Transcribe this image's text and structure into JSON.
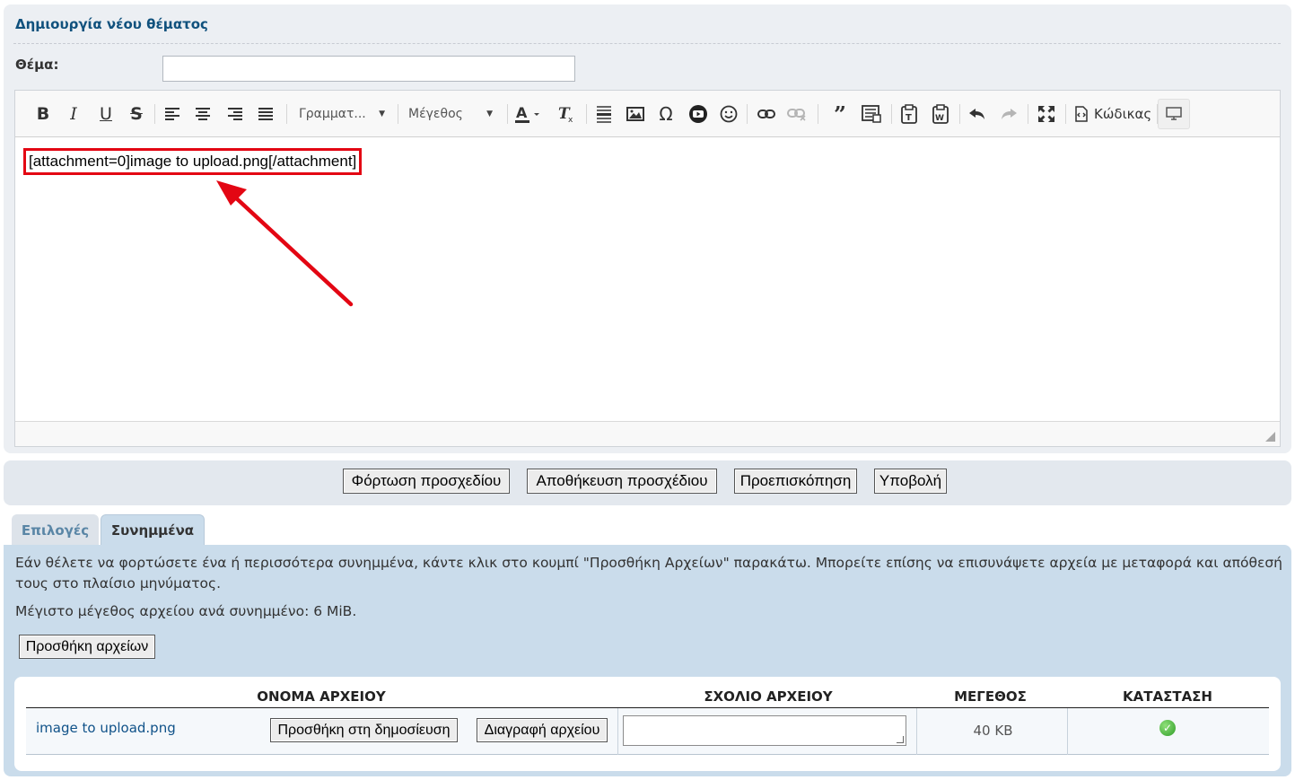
{
  "form": {
    "title": "Δημιουργία νέου θέματος",
    "subject_label": "Θέμα:",
    "subject_value": ""
  },
  "toolbar": {
    "font_combo": "Γραμματ...",
    "size_combo": "Μέγεθος",
    "source_label": "Κώδικας",
    "icons": [
      "bold-icon",
      "italic-icon",
      "underline-icon",
      "strike-icon",
      "align-left-icon",
      "align-center-icon",
      "align-right-icon",
      "justify-icon",
      "text-color-icon",
      "remove-format-icon",
      "horizontal-rule-icon",
      "image-icon",
      "special-char-icon",
      "youtube-icon",
      "smiley-icon",
      "link-icon",
      "unlink-icon",
      "blockquote-icon",
      "code-block-icon",
      "paste-text-icon",
      "paste-word-icon",
      "undo-icon",
      "redo-icon",
      "maximize-icon",
      "source-icon",
      "preview-icon"
    ]
  },
  "editor": {
    "content": "[attachment=0]image to upload.png[/attachment]",
    "highlight_color": "#e30613"
  },
  "actions": {
    "load_draft": "Φόρτωση προσχεδίου",
    "save_draft": "Αποθήκευση προσχέδιου",
    "preview": "Προεπισκόπηση",
    "submit": "Υποβολή"
  },
  "tabs": {
    "options": "Επιλογές",
    "attachments": "Συνημμένα"
  },
  "attachments": {
    "intro": "Εάν θέλετε να φορτώσετε ένα ή περισσότερα συνημμένα, κάντε κλικ στο κουμπί \"Προσθήκη Αρχείων\" παρακάτω. Μπορείτε επίσης να επισυνάψετε αρχεία με μεταφορά και απόθεσή τους στο πλαίσιο μηνύματος.",
    "max_size": "Μέγιστο μέγεθος αρχείου ανά συνημμένο: 6 MiB.",
    "add_files": "Προσθήκη αρχείων",
    "columns": {
      "name": "ΟΝΟΜΑ ΑΡΧΕΙΟΥ",
      "comment": "ΣΧΟΛΙΟ ΑΡΧΕΙΟΥ",
      "size": "ΜΕΓΕΘΟΣ",
      "status": "ΚΑΤΑΣΤΑΣΗ"
    },
    "rows": [
      {
        "name": "image to upload.png",
        "place_inline": "Προσθήκη στη δημοσίευση",
        "delete": "Διαγραφή αρχείου",
        "comment": "",
        "size": "40 KB",
        "status_icon": "check-circle-icon"
      }
    ]
  }
}
